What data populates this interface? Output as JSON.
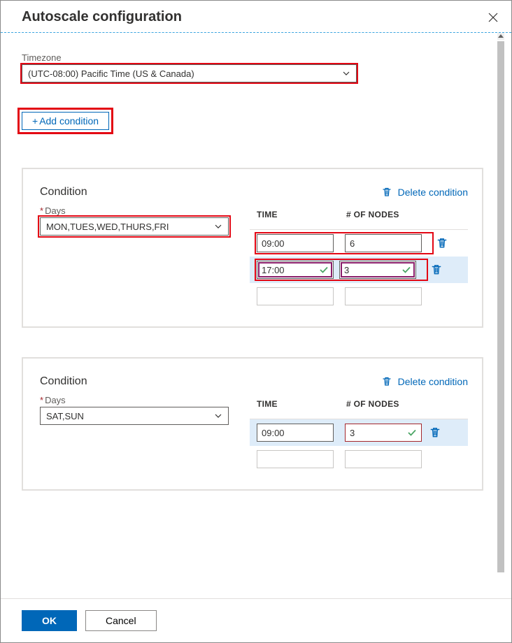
{
  "header": {
    "title": "Autoscale configuration"
  },
  "timezone": {
    "label": "Timezone",
    "value": "(UTC-08:00) Pacific Time (US & Canada)"
  },
  "add_condition_label": "Add condition",
  "table_headers": {
    "time": "TIME",
    "nodes": "# OF NODES"
  },
  "common": {
    "days_label": "Days",
    "delete_label": "Delete condition",
    "condition_title": "Condition"
  },
  "conditions": [
    {
      "days": "MON,TUES,WED,THURS,FRI",
      "rows": [
        {
          "time": "09:00",
          "nodes": "6"
        },
        {
          "time": "17:00",
          "nodes": "3"
        }
      ]
    },
    {
      "days": "SAT,SUN",
      "rows": [
        {
          "time": "09:00",
          "nodes": "3"
        }
      ]
    }
  ],
  "footer": {
    "ok": "OK",
    "cancel": "Cancel"
  }
}
